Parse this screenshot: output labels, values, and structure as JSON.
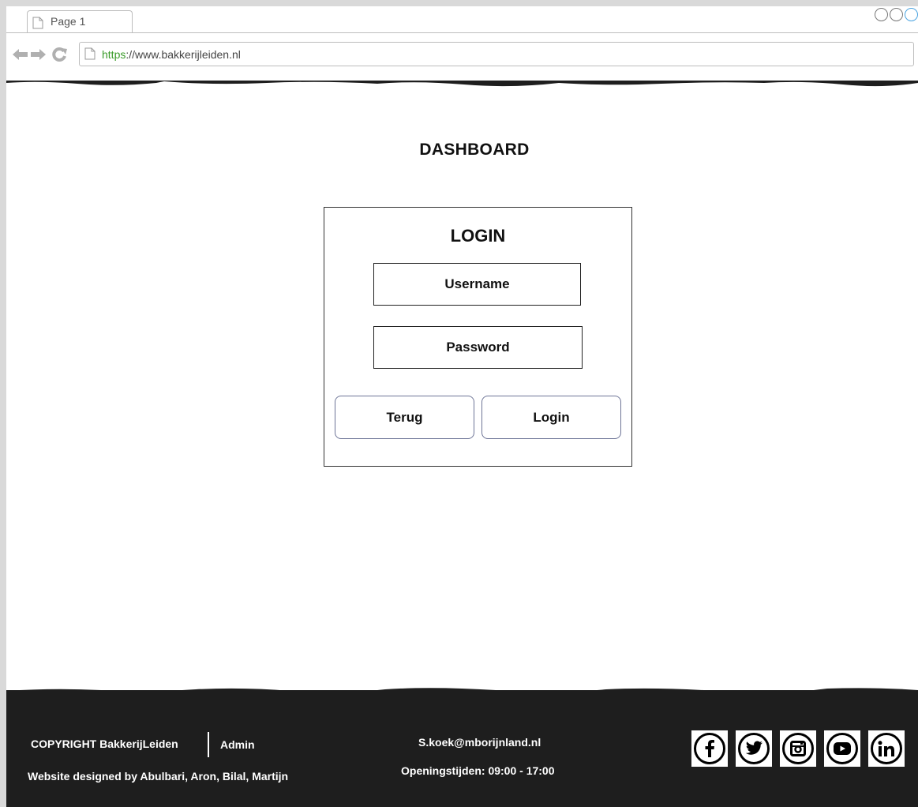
{
  "browser": {
    "tab_title": "Page 1",
    "url_protocol": "https",
    "url_rest": "://www.bakkerijleiden.nl"
  },
  "page": {
    "title": "DASHBOARD"
  },
  "login": {
    "title": "LOGIN",
    "username_label": "Username",
    "password_label": "Password",
    "back_label": "Terug",
    "login_label": "Login"
  },
  "footer": {
    "copyright": "COPYRIGHT BakkerijLeiden",
    "admin": "Admin",
    "designed_by": "Website designed by  Abulbari, Aron, Bilal, Martijn",
    "email": "S.koek@mborijnland.nl",
    "hours": "Openingstijden: 09:00 - 17:00",
    "socials": [
      {
        "icon": "facebook-icon",
        "glyph": "f"
      },
      {
        "icon": "twitter-icon",
        "glyph": "t"
      },
      {
        "icon": "instagram-icon",
        "glyph": "ig"
      },
      {
        "icon": "youtube-icon",
        "glyph": "yt"
      },
      {
        "icon": "linkedin-icon",
        "glyph": "in"
      }
    ]
  },
  "colors": {
    "footer_bg": "#1e1e1e",
    "url_protocol": "#3a9b2a",
    "button_border": "#6e7597"
  }
}
